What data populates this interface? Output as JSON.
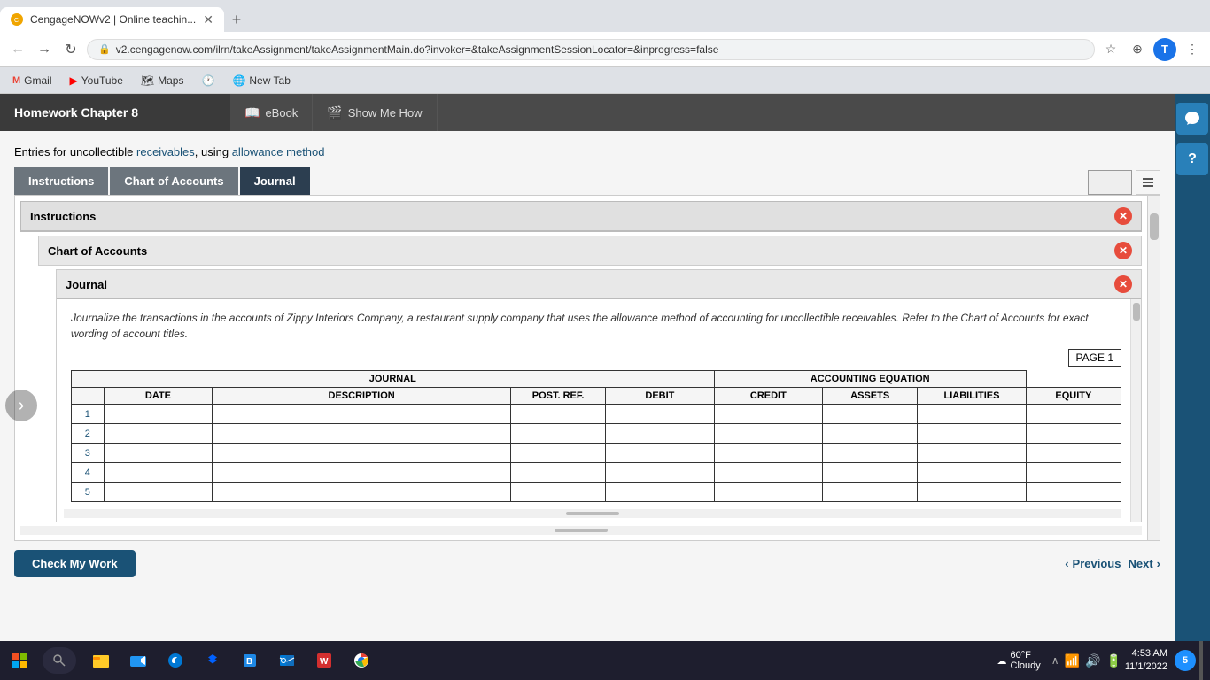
{
  "browser": {
    "tab_title": "CengageNOWv2 | Online teachin...",
    "url": "v2.cengagenow.com/ilrn/takeAssignment/takeAssignmentMain.do?invoker=&takeAssignmentSessionLocator=&inprogress=false",
    "new_tab_label": "New Tab",
    "bookmarks": [
      {
        "id": "gmail",
        "label": "Gmail",
        "icon": "M"
      },
      {
        "id": "youtube",
        "label": "YouTube",
        "icon": "▶"
      },
      {
        "id": "maps",
        "label": "Maps",
        "icon": "📍"
      },
      {
        "id": "extension",
        "label": "",
        "icon": "🕐"
      },
      {
        "id": "newtab",
        "label": "New Tab",
        "icon": "+"
      }
    ]
  },
  "app": {
    "title": "Homework Chapter 8",
    "header_tabs": [
      {
        "id": "ebook",
        "label": "eBook",
        "icon": "📖"
      },
      {
        "id": "showmehow",
        "label": "Show Me How",
        "icon": "🎬"
      }
    ]
  },
  "problem": {
    "intro_text": "Entries for uncollectible ",
    "link1": "receivables",
    "comma_text": ", using ",
    "link2": "allowance method"
  },
  "tabs": [
    {
      "id": "instructions",
      "label": "Instructions",
      "active": false
    },
    {
      "id": "chart",
      "label": "Chart of Accounts",
      "active": false
    },
    {
      "id": "journal",
      "label": "Journal",
      "active": true
    }
  ],
  "panels": {
    "instructions": {
      "title": "Instructions",
      "visible": true
    },
    "chart_of_accounts": {
      "title": "Chart of Accounts",
      "visible": true
    },
    "journal": {
      "title": "Journal",
      "visible": true,
      "instruction": "Journalize the transactions in the accounts of Zippy Interiors Company, a restaurant supply company that uses the allowance method of accounting for uncollectible receivables. Refer to the Chart of Accounts for exact wording of account titles.",
      "page_label": "PAGE",
      "page_number": "1",
      "table": {
        "journal_header": "JOURNAL",
        "accounting_header": "ACCOUNTING EQUATION",
        "columns": [
          "DATE",
          "DESCRIPTION",
          "POST. REF.",
          "DEBIT",
          "CREDIT",
          "ASSETS",
          "LIABILITIES",
          "EQUITY"
        ],
        "rows": [
          1,
          2,
          3,
          4,
          5
        ]
      }
    }
  },
  "bottom": {
    "check_btn": "Check My Work",
    "prev_btn": "Previous",
    "next_btn": "Next"
  },
  "sidebar": {
    "buttons": [
      "?",
      "?"
    ]
  },
  "taskbar": {
    "time": "4:53 AM",
    "date": "11/1/2022",
    "weather_temp": "60°F",
    "weather_desc": "Cloudy",
    "notification": "5"
  }
}
